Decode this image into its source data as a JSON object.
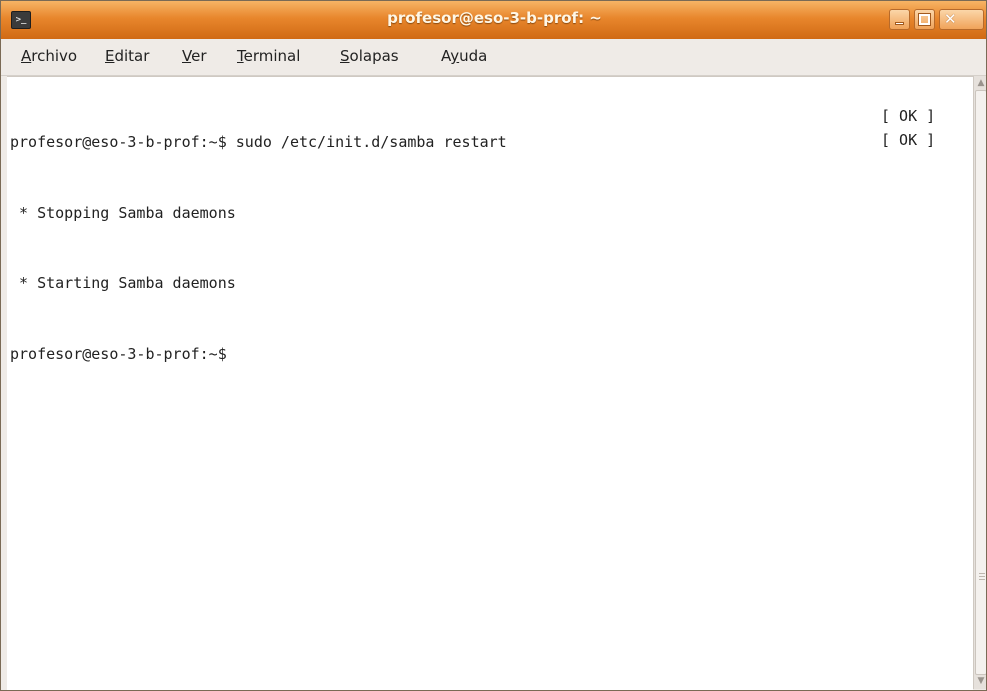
{
  "window": {
    "title": "profesor@eso-3-b-prof: ~",
    "icon": "terminal-icon",
    "controls": {
      "minimize": "minimize-icon",
      "maximize": "maximize-icon",
      "close": "close-icon",
      "close_glyph": "✕"
    },
    "accent_color": "#e8862c"
  },
  "menu": {
    "items": [
      {
        "first": "A",
        "rest": "rchivo"
      },
      {
        "first": "E",
        "rest": "ditar"
      },
      {
        "first": "V",
        "rest": "er"
      },
      {
        "first": "T",
        "rest": "erminal"
      },
      {
        "first": "S",
        "rest": "olapas"
      },
      {
        "first": "",
        "ulpre": "A",
        "u": "y",
        "post": "uda"
      }
    ]
  },
  "terminal": {
    "lines": [
      "profesor@eso-3-b-prof:~$ sudo /etc/init.d/samba restart",
      " * Stopping Samba daemons",
      " * Starting Samba daemons",
      "profesor@eso-3-b-prof:~$"
    ],
    "status": [
      "[ OK ]",
      "[ OK ]"
    ]
  }
}
